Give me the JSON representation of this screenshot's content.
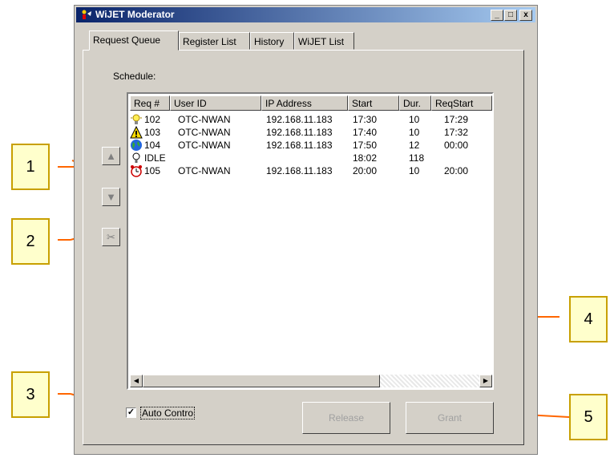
{
  "window": {
    "title": "WiJET Moderator",
    "minimize": "_",
    "maximize": "□",
    "close": "x"
  },
  "tabs": [
    {
      "label": "Request Queue",
      "active": true
    },
    {
      "label": "Register List"
    },
    {
      "label": "History"
    },
    {
      "label": "WiJET List"
    }
  ],
  "schedule_label": "Schedule:",
  "table": {
    "columns": [
      "Req #",
      "User ID",
      "IP Address",
      "Start",
      "Dur.",
      "ReqStart"
    ],
    "rows": [
      {
        "icon": "lightbulb-icon",
        "req": "102",
        "user": "OTC-NWAN",
        "ip": "192.168.11.183",
        "start": "17:30",
        "dur": "10",
        "reqstart": "17:29"
      },
      {
        "icon": "warning-icon",
        "req": "103",
        "user": "OTC-NWAN",
        "ip": "192.168.11.183",
        "start": "17:40",
        "dur": "10",
        "reqstart": "17:32"
      },
      {
        "icon": "globe-icon",
        "req": "104",
        "user": "OTC-NWAN",
        "ip": "192.168.11.183",
        "start": "17:50",
        "dur": "12",
        "reqstart": "00:00"
      },
      {
        "icon": "idle-bulb-icon",
        "req": "IDLE",
        "user": "",
        "ip": "",
        "start": "18:02",
        "dur": "118",
        "reqstart": ""
      },
      {
        "icon": "alarm-clock-icon",
        "req": "105",
        "user": "OTC-NWAN",
        "ip": "192.168.11.183",
        "start": "20:00",
        "dur": "10",
        "reqstart": "20:00"
      }
    ]
  },
  "side_buttons": {
    "up": "▲",
    "down": "▼",
    "cut": "✂"
  },
  "scroll": {
    "left": "◀",
    "right": "▶"
  },
  "auto_control": {
    "label": "Auto Contro",
    "checked": true,
    "mark": "✓"
  },
  "buttons": {
    "release": "Release",
    "grant": "Grant"
  },
  "callouts": [
    "1",
    "2",
    "3",
    "4",
    "5"
  ],
  "colors": {
    "callout_fill": "#ffffcc",
    "callout_border": "#c8a000",
    "leader": "#ff6600"
  }
}
